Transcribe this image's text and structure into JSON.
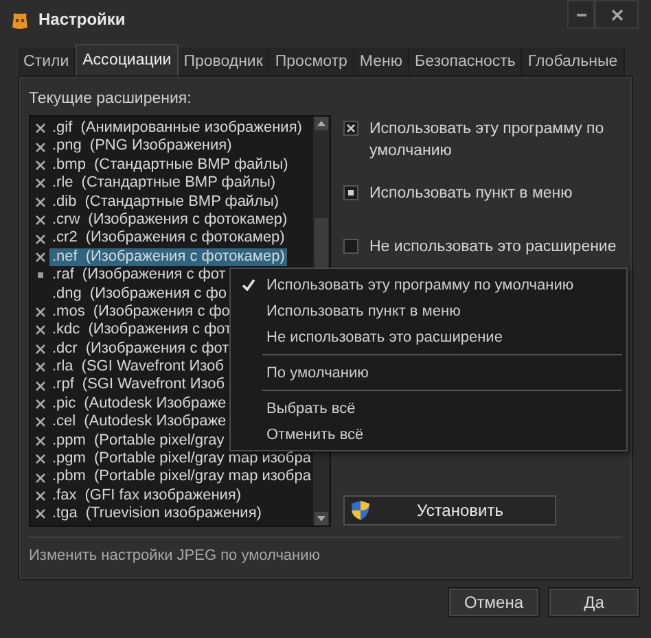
{
  "window": {
    "title": "Настройки"
  },
  "tabs": [
    {
      "label": "Стили",
      "selected": false
    },
    {
      "label": "Ассоциации",
      "selected": true
    },
    {
      "label": "Проводник",
      "selected": false
    },
    {
      "label": "Просмотр",
      "selected": false
    },
    {
      "label": "Меню",
      "selected": false
    },
    {
      "label": "Безопасность",
      "selected": false
    },
    {
      "label": "Глобальные",
      "selected": false
    }
  ],
  "list_label": "Текущие расширения:",
  "extensions": [
    {
      "ext": ".gif",
      "description": "(Анимированные изображения)",
      "checked": true,
      "partial": false,
      "selected": false
    },
    {
      "ext": ".png",
      "description": "(PNG Изображения)",
      "checked": true,
      "partial": false,
      "selected": false
    },
    {
      "ext": ".bmp",
      "description": "(Стандартные BMP файлы)",
      "checked": true,
      "partial": false,
      "selected": false
    },
    {
      "ext": ".rle",
      "description": "(Стандартные BMP файлы)",
      "checked": true,
      "partial": false,
      "selected": false
    },
    {
      "ext": ".dib",
      "description": "(Стандартные BMP файлы)",
      "checked": true,
      "partial": false,
      "selected": false
    },
    {
      "ext": ".crw",
      "description": "(Изображения с фотокамер)",
      "checked": true,
      "partial": false,
      "selected": false
    },
    {
      "ext": ".cr2",
      "description": "(Изображения с фотокамер)",
      "checked": true,
      "partial": false,
      "selected": false
    },
    {
      "ext": ".nef",
      "description": "(Изображения с фотокамер)",
      "checked": true,
      "partial": false,
      "selected": true
    },
    {
      "ext": ".raf",
      "description": "(Изображения с фот",
      "checked": false,
      "partial": true,
      "selected": false
    },
    {
      "ext": ".dng",
      "description": "(Изображения с фо",
      "checked": false,
      "partial": false,
      "selected": false
    },
    {
      "ext": ".mos",
      "description": "(Изображения с фо",
      "checked": true,
      "partial": false,
      "selected": false
    },
    {
      "ext": ".kdc",
      "description": "(Изображения с фот",
      "checked": true,
      "partial": false,
      "selected": false
    },
    {
      "ext": ".dcr",
      "description": "(Изображения с фот",
      "checked": true,
      "partial": false,
      "selected": false
    },
    {
      "ext": ".rla",
      "description": "(SGI Wavefront Изоб",
      "checked": true,
      "partial": false,
      "selected": false
    },
    {
      "ext": ".rpf",
      "description": "(SGI Wavefront Изоб",
      "checked": true,
      "partial": false,
      "selected": false
    },
    {
      "ext": ".pic",
      "description": "(Autodesk Изображе",
      "checked": true,
      "partial": false,
      "selected": false
    },
    {
      "ext": ".cel",
      "description": "(Autodesk Изображе",
      "checked": true,
      "partial": false,
      "selected": false
    },
    {
      "ext": ".ppm",
      "description": "(Portable pixel/gray",
      "checked": true,
      "partial": false,
      "selected": false
    },
    {
      "ext": ".pgm",
      "description": "(Portable pixel/gray map изобра",
      "checked": true,
      "partial": false,
      "selected": false
    },
    {
      "ext": ".pbm",
      "description": "(Portable pixel/gray map изобра",
      "checked": true,
      "partial": false,
      "selected": false
    },
    {
      "ext": ".fax",
      "description": "(GFI fax изображения)",
      "checked": true,
      "partial": false,
      "selected": false
    },
    {
      "ext": ".tga",
      "description": "(Truevision изображения)",
      "checked": true,
      "partial": false,
      "selected": false
    }
  ],
  "options": [
    {
      "label": "Использовать эту программу по умолчанию",
      "checked": true,
      "partial": false
    },
    {
      "label": "Использовать пункт в меню",
      "checked": false,
      "partial": true
    },
    {
      "label": "Не использовать это расширение",
      "checked": false,
      "partial": false
    }
  ],
  "context_menu": [
    {
      "kind": "item",
      "label": "Использовать эту программу по умолчанию",
      "checked": true
    },
    {
      "kind": "item",
      "label": "Использовать пункт в меню",
      "checked": false
    },
    {
      "kind": "item",
      "label": "Не использовать это расширение",
      "checked": false
    },
    {
      "kind": "separator"
    },
    {
      "kind": "item",
      "label": "По умолчанию",
      "checked": false
    },
    {
      "kind": "separator"
    },
    {
      "kind": "item",
      "label": "Выбрать всё",
      "checked": false
    },
    {
      "kind": "item",
      "label": "Отменить всё",
      "checked": false
    }
  ],
  "install_button": "Установить",
  "hint": "Изменить настройки JPEG по умолчанию",
  "buttons": [
    "Отмена",
    "Да"
  ]
}
